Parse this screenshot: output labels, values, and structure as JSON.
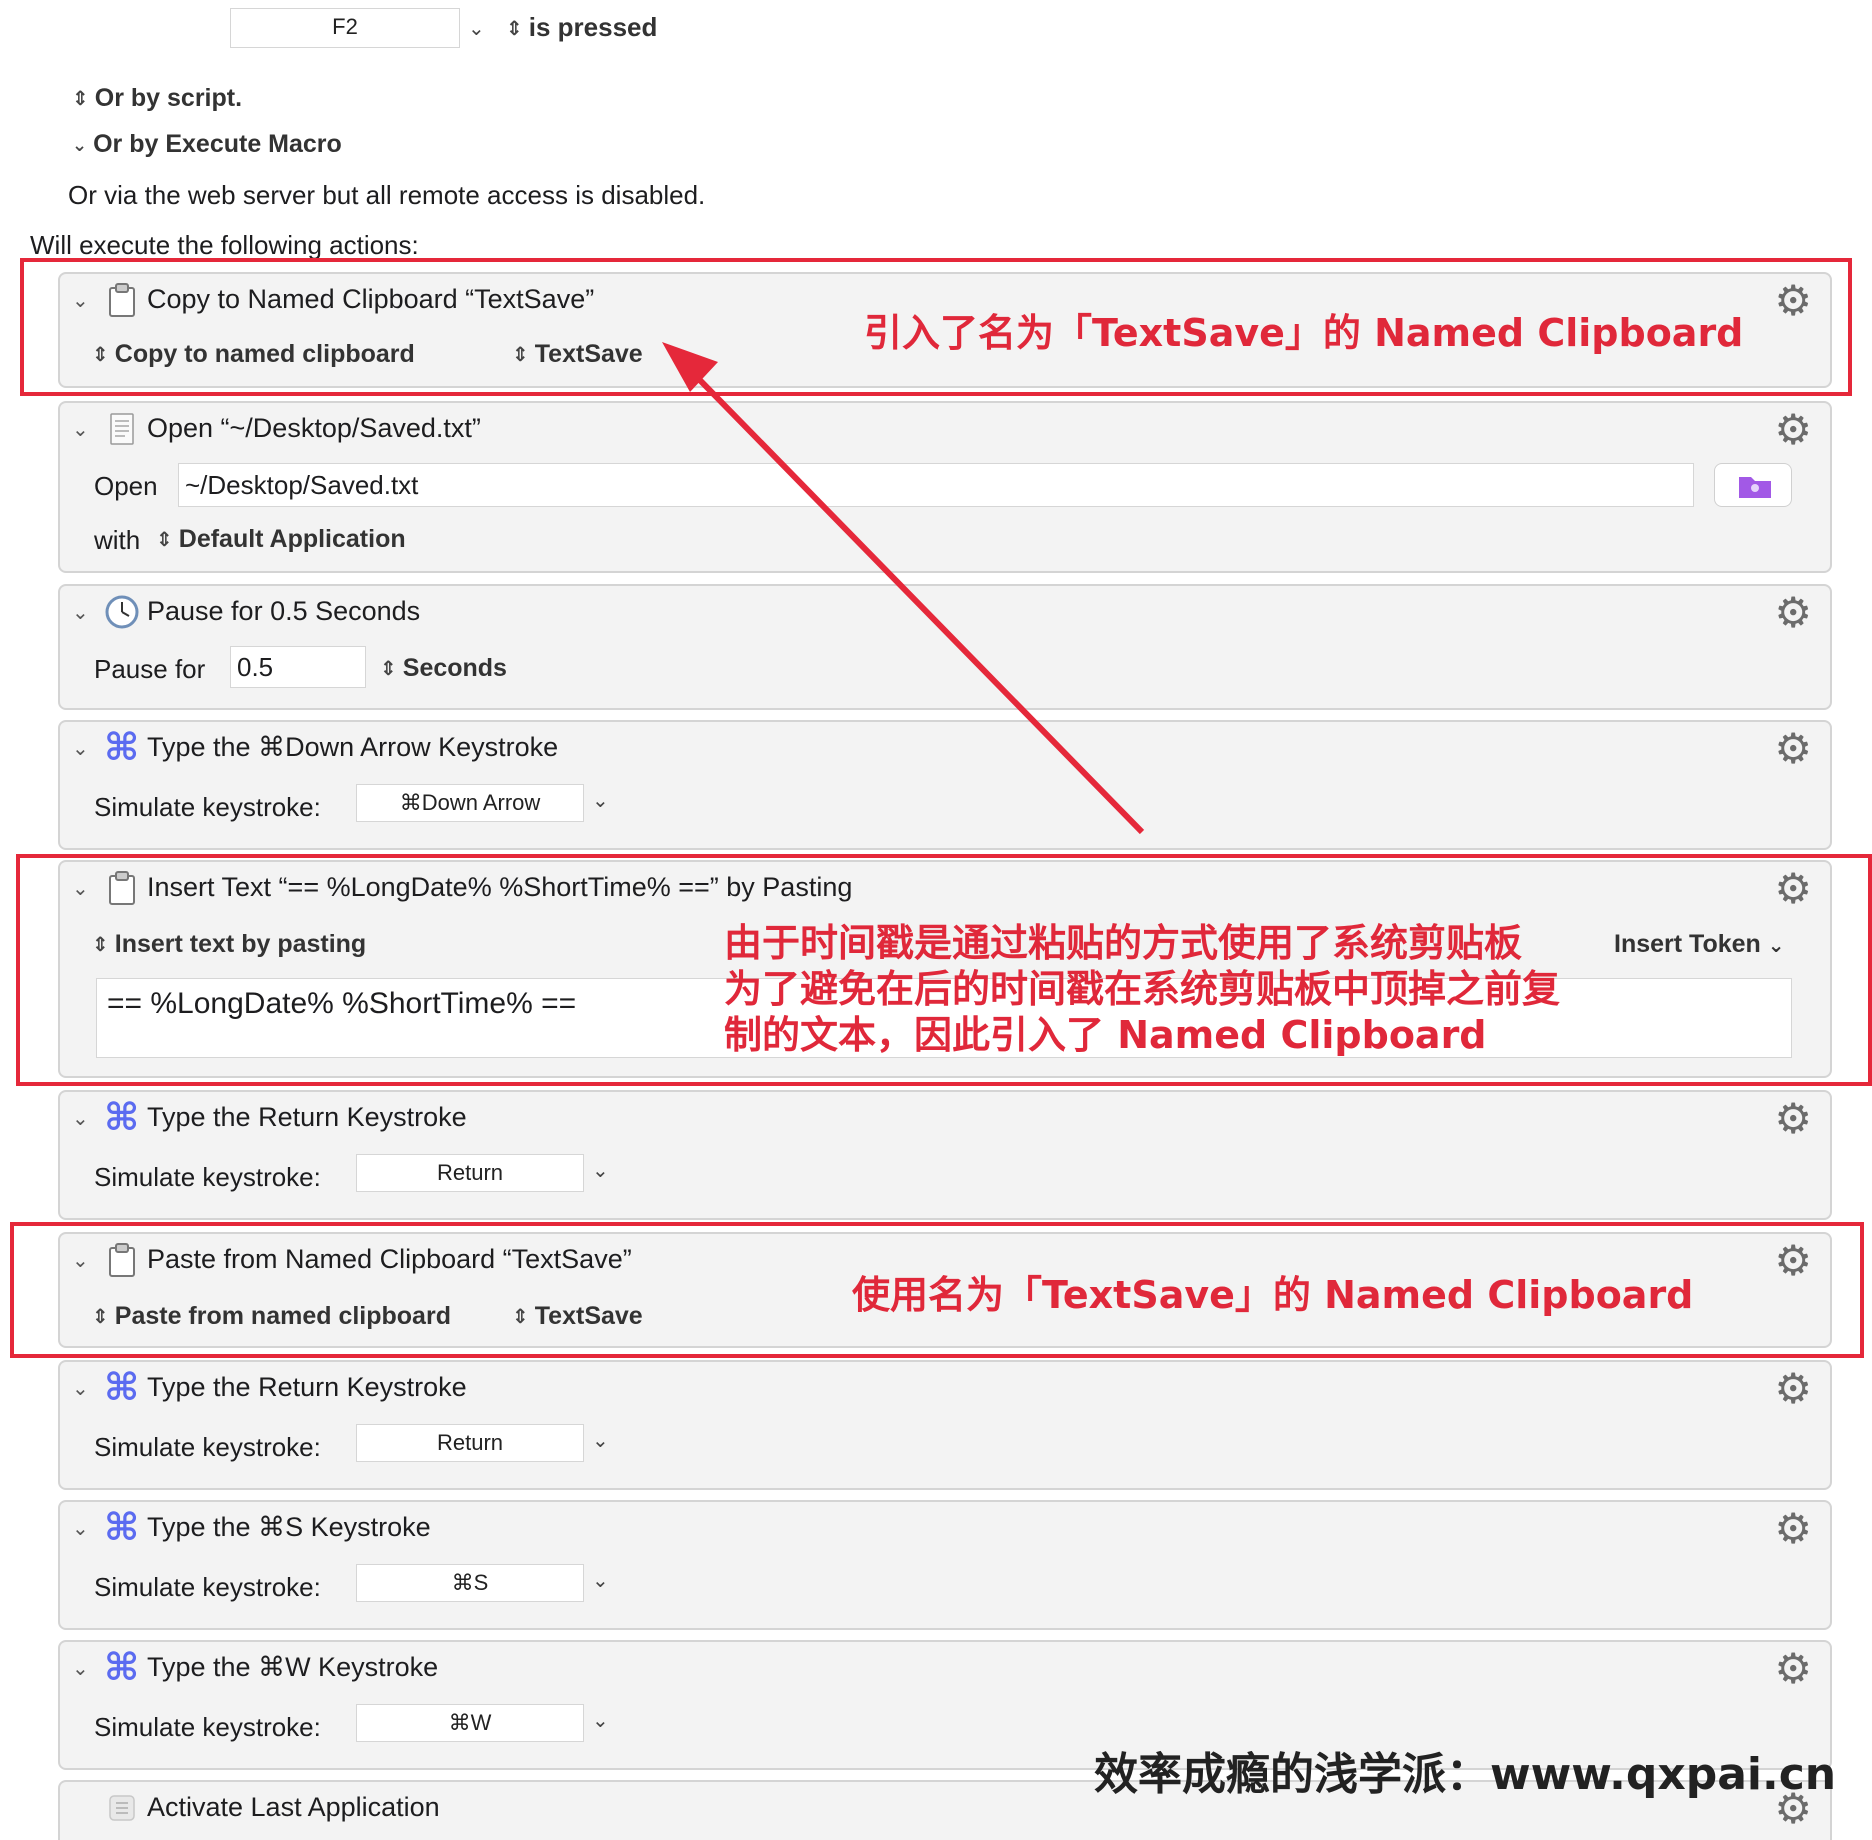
{
  "trigger": {
    "key_value": "F2",
    "state": "is pressed",
    "or_script": "Or by script.",
    "or_execute_macro": "Or by Execute Macro",
    "web_server_note": "Or via the web server but all remote access is disabled.",
    "actions_heading": "Will execute the following actions:"
  },
  "actions": [
    {
      "title": "Copy to Named Clipboard “TextSave”",
      "mode": "Copy to named clipboard",
      "clipboard": "TextSave"
    },
    {
      "title": "Open “~/Desktop/Saved.txt”",
      "open_label": "Open",
      "path": "~/Desktop/Saved.txt",
      "with_label": "with",
      "application": "Default Application"
    },
    {
      "title": "Pause for 0.5 Seconds",
      "pause_label": "Pause for",
      "value": "0.5",
      "unit": "Seconds"
    },
    {
      "title": "Type the ⌘Down Arrow Keystroke",
      "simulate_label": "Simulate keystroke:",
      "keystroke": "⌘Down Arrow"
    },
    {
      "title": "Insert Text “== %LongDate% %ShortTime% ==” by Pasting",
      "mode": "Insert text by pasting",
      "insert_token": "Insert Token",
      "text": "== %LongDate% %ShortTime% =="
    },
    {
      "title": "Type the Return Keystroke",
      "simulate_label": "Simulate keystroke:",
      "keystroke": "Return"
    },
    {
      "title": "Paste from Named Clipboard “TextSave”",
      "mode": "Paste from named clipboard",
      "clipboard": "TextSave"
    },
    {
      "title": "Type the Return Keystroke",
      "simulate_label": "Simulate keystroke:",
      "keystroke": "Return"
    },
    {
      "title": "Type the ⌘S Keystroke",
      "simulate_label": "Simulate keystroke:",
      "keystroke": "⌘S"
    },
    {
      "title": "Type the ⌘W Keystroke",
      "simulate_label": "Simulate keystroke:",
      "keystroke": "⌘W"
    },
    {
      "title": "Activate Last Application"
    }
  ],
  "annotations": {
    "copy_note": "引入了名为「TextSave」的 Named Clipboard",
    "insert_note_line1": "由于时间戳是通过粘贴的方式使用了系统剪贴板",
    "insert_note_line2": "为了避免在后的时间戳在系统剪贴板中顶掉之前复",
    "insert_note_line3": "制的文本，因此引入了 Named Clipboard",
    "paste_note": "使用名为「TextSave」的 Named Clipboard",
    "footer": "效率成瘾的浅学派：www.qxpai.cn"
  },
  "colors": {
    "annotation_red": "#e5283a",
    "command_icon_blue": "#5b6bf0",
    "folder_purple": "#a259e6"
  },
  "icons": {
    "gear": "gear-icon",
    "clipboard": "clipboard-icon",
    "document": "document-icon",
    "clock": "clock-icon",
    "command": "command-key-icon",
    "folder": "folder-icon",
    "app": "application-icon"
  }
}
